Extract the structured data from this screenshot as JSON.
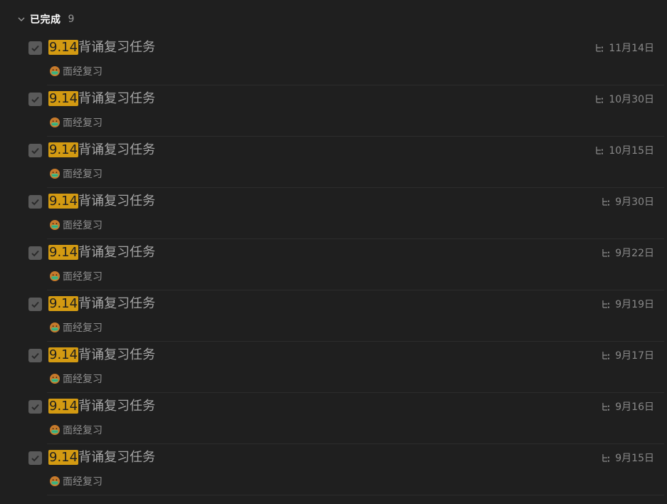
{
  "section": {
    "title": "已完成",
    "count": "9"
  },
  "colors": {
    "background": "#1f1f1f",
    "highlight": "#d39a12",
    "checkbox": "#5a5a5a"
  },
  "tasks": [
    {
      "highlight": "9.14",
      "title": "背诵复习任务",
      "date": "11月14日",
      "tag": "面经复习"
    },
    {
      "highlight": "9.14",
      "title": "背诵复习任务",
      "date": "10月30日",
      "tag": "面经复习"
    },
    {
      "highlight": "9.14",
      "title": "背诵复习任务",
      "date": "10月15日",
      "tag": "面经复习"
    },
    {
      "highlight": "9.14",
      "title": "背诵复习任务",
      "date": "9月30日",
      "tag": "面经复习"
    },
    {
      "highlight": "9.14",
      "title": "背诵复习任务",
      "date": "9月22日",
      "tag": "面经复习"
    },
    {
      "highlight": "9.14",
      "title": "背诵复习任务",
      "date": "9月19日",
      "tag": "面经复习"
    },
    {
      "highlight": "9.14",
      "title": "背诵复习任务",
      "date": "9月17日",
      "tag": "面经复习"
    },
    {
      "highlight": "9.14",
      "title": "背诵复习任务",
      "date": "9月16日",
      "tag": "面经复习"
    },
    {
      "highlight": "9.14",
      "title": "背诵复习任务",
      "date": "9月15日",
      "tag": "面经复习"
    }
  ]
}
